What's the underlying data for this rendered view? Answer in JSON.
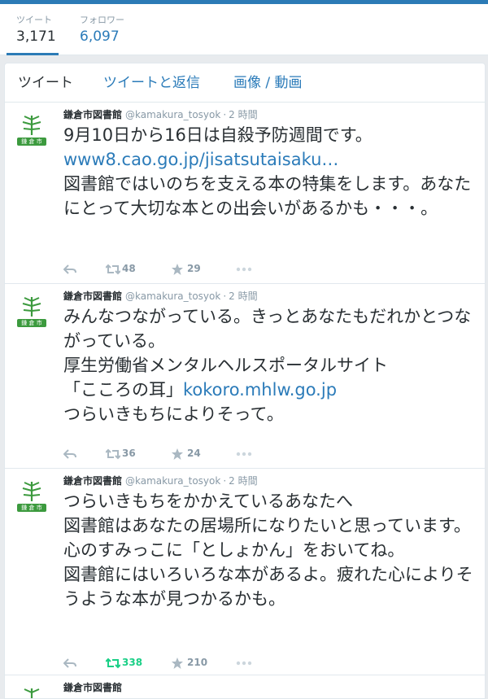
{
  "profile_nav": {
    "tweets_label": "ツイート",
    "tweets_count": "3,171",
    "followers_label": "フォロワー",
    "followers_count": "6,097"
  },
  "timeline_tabs": [
    "ツイート",
    "ツイートと返信",
    "画像 / 動画"
  ],
  "colors": {
    "accent": "#2b7bb9",
    "retweet_active": "#19cf86",
    "muted": "#8899a6",
    "avatar_green": "#3c9a3e"
  },
  "tweets": [
    {
      "name": "鎌倉市図書館",
      "handle": "@kamakura_tosyok",
      "separator": "·",
      "time": "2 時間",
      "avatar_text": "鎌 倉 市",
      "lines": [
        "9月10日から16日は自殺予防週間です。"
      ],
      "link": "www8.cao.go.jp/jisatsutaisaku…",
      "lines_after": [
        "図書館ではいのちを支える本の特集をします。あなたにとって大切な本との出会いがあるかも・・・。"
      ],
      "retweets": "48",
      "favorites": "29",
      "retweet_active": false
    },
    {
      "name": "鎌倉市図書館",
      "handle": "@kamakura_tosyok",
      "separator": "·",
      "time": "2 時間",
      "avatar_text": "鎌 倉 市",
      "line1": "みんなつながっている。きっとあなたもだれかとつながっている。",
      "line2": "厚生労働省メンタルヘルスポータルサイト",
      "line3_prefix": "「こころの耳」",
      "link": "kokoro.mhlw.go.jp",
      "line4": "つらいきもちによりそって。",
      "retweets": "36",
      "favorites": "24",
      "retweet_active": false
    },
    {
      "name": "鎌倉市図書館",
      "handle": "@kamakura_tosyok",
      "separator": "·",
      "time": "2 時間",
      "avatar_text": "鎌 倉 市",
      "line1": "つらいきもちをかかえているあなたへ",
      "line2": "図書館はあなたの居場所になりたいと思っています。心のすみっこに「としょかん」をおいてね。",
      "line3": "図書館にはいろいろな本があるよ。疲れた心によりそうような本が見つかるかも。",
      "retweets": "338",
      "favorites": "210",
      "retweet_active": true
    },
    {
      "name": "鎌倉市図書館"
    }
  ],
  "icons": [
    "reply-icon",
    "retweet-icon",
    "favorite-star-icon",
    "more-dots-icon",
    "bamboo-logo-icon"
  ]
}
